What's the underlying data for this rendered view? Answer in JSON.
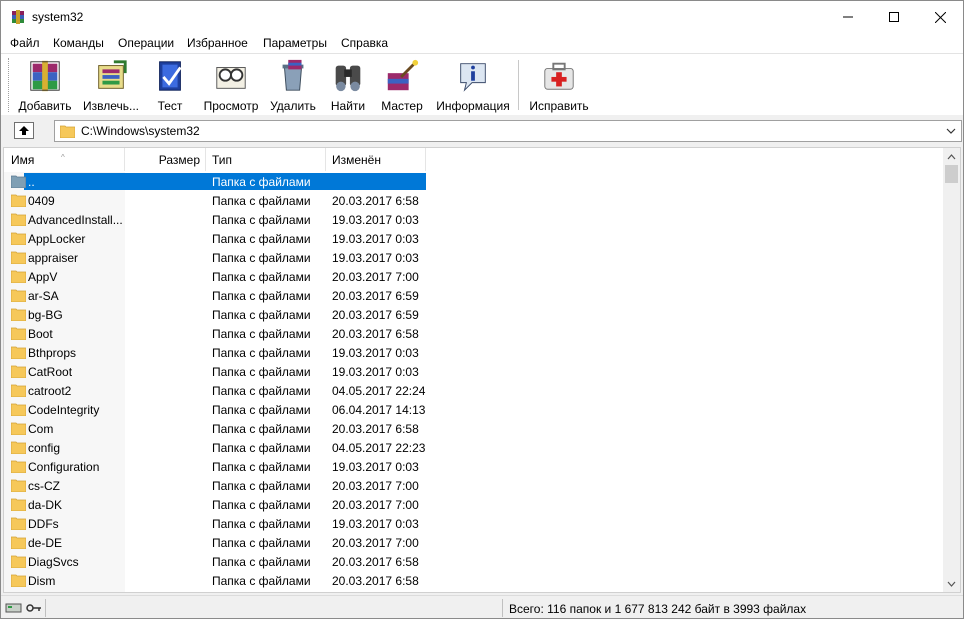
{
  "window": {
    "title": "system32"
  },
  "menu": [
    "Файл",
    "Команды",
    "Операции",
    "Избранное",
    "Параметры",
    "Справка"
  ],
  "toolbar": {
    "buttons": [
      {
        "label": "Добавить",
        "icon": "add-archive-icon"
      },
      {
        "label": "Извлечь...",
        "icon": "extract-icon"
      },
      {
        "label": "Тест",
        "icon": "test-icon"
      },
      {
        "label": "Просмотр",
        "icon": "view-icon"
      },
      {
        "label": "Удалить",
        "icon": "delete-icon"
      },
      {
        "label": "Найти",
        "icon": "find-icon"
      },
      {
        "label": "Мастер",
        "icon": "wizard-icon"
      },
      {
        "label": "Информация",
        "icon": "info-icon"
      },
      {
        "label": "Исправить",
        "icon": "repair-icon"
      }
    ]
  },
  "address": {
    "path": "C:\\Windows\\system32"
  },
  "columns": {
    "name": "Имя",
    "size": "Размер",
    "type": "Тип",
    "modified": "Изменён"
  },
  "rows": [
    {
      "name": "..",
      "type": "Папка с файлами",
      "modified": "",
      "selected": true
    },
    {
      "name": "0409",
      "type": "Папка с файлами",
      "modified": "20.03.2017 6:58"
    },
    {
      "name": "AdvancedInstall...",
      "type": "Папка с файлами",
      "modified": "19.03.2017 0:03"
    },
    {
      "name": "AppLocker",
      "type": "Папка с файлами",
      "modified": "19.03.2017 0:03"
    },
    {
      "name": "appraiser",
      "type": "Папка с файлами",
      "modified": "19.03.2017 0:03"
    },
    {
      "name": "AppV",
      "type": "Папка с файлами",
      "modified": "20.03.2017 7:00"
    },
    {
      "name": "ar-SA",
      "type": "Папка с файлами",
      "modified": "20.03.2017 6:59"
    },
    {
      "name": "bg-BG",
      "type": "Папка с файлами",
      "modified": "20.03.2017 6:59"
    },
    {
      "name": "Boot",
      "type": "Папка с файлами",
      "modified": "20.03.2017 6:58"
    },
    {
      "name": "Bthprops",
      "type": "Папка с файлами",
      "modified": "19.03.2017 0:03"
    },
    {
      "name": "CatRoot",
      "type": "Папка с файлами",
      "modified": "19.03.2017 0:03"
    },
    {
      "name": "catroot2",
      "type": "Папка с файлами",
      "modified": "04.05.2017 22:24"
    },
    {
      "name": "CodeIntegrity",
      "type": "Папка с файлами",
      "modified": "06.04.2017 14:13"
    },
    {
      "name": "Com",
      "type": "Папка с файлами",
      "modified": "20.03.2017 6:58"
    },
    {
      "name": "config",
      "type": "Папка с файлами",
      "modified": "04.05.2017 22:23"
    },
    {
      "name": "Configuration",
      "type": "Папка с файлами",
      "modified": "19.03.2017 0:03"
    },
    {
      "name": "cs-CZ",
      "type": "Папка с файлами",
      "modified": "20.03.2017 7:00"
    },
    {
      "name": "da-DK",
      "type": "Папка с файлами",
      "modified": "20.03.2017 7:00"
    },
    {
      "name": "DDFs",
      "type": "Папка с файлами",
      "modified": "19.03.2017 0:03"
    },
    {
      "name": "de-DE",
      "type": "Папка с файлами",
      "modified": "20.03.2017 7:00"
    },
    {
      "name": "DiagSvcs",
      "type": "Папка с файлами",
      "modified": "20.03.2017 6:58"
    },
    {
      "name": "Dism",
      "type": "Папка с файлами",
      "modified": "20.03.2017 6:58"
    }
  ],
  "status": {
    "summary": "Всего: 116 папок и 1 677 813 242 байт в 3993 файлах"
  },
  "colors": {
    "selection": "#0078d7",
    "folder": "#f6c85a"
  }
}
